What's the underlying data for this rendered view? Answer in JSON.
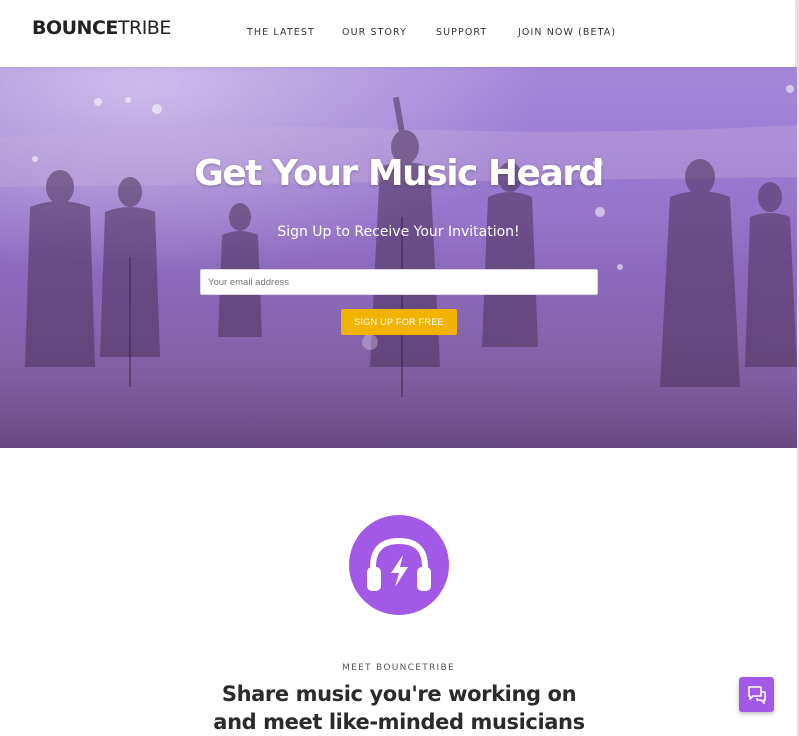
{
  "brand": {
    "logo_bold": "BOUNCE",
    "logo_light": "TRIBE"
  },
  "nav": {
    "items": [
      {
        "label": "THE LATEST"
      },
      {
        "label": "OUR STORY"
      },
      {
        "label": "SUPPORT"
      },
      {
        "label": "JOIN NOW (BETA)"
      }
    ]
  },
  "hero": {
    "title": "Get Your Music Heard",
    "subtitle": "Sign Up to Receive Your Invitation!",
    "email_placeholder": "Your email address",
    "email_value": "",
    "cta_label": "SIGN UP FOR FREE",
    "overlay_color": "#9b6fd6"
  },
  "feature": {
    "icon": "headphones-bolt-icon",
    "eyebrow": "MEET BOUNCETRIBE",
    "title": "Share music you're working on and meet like-minded musicians"
  },
  "chat": {
    "icon": "chat-bubbles-icon"
  },
  "colors": {
    "accent_purple": "#a259e6",
    "cta_yellow": "#f0b400"
  }
}
